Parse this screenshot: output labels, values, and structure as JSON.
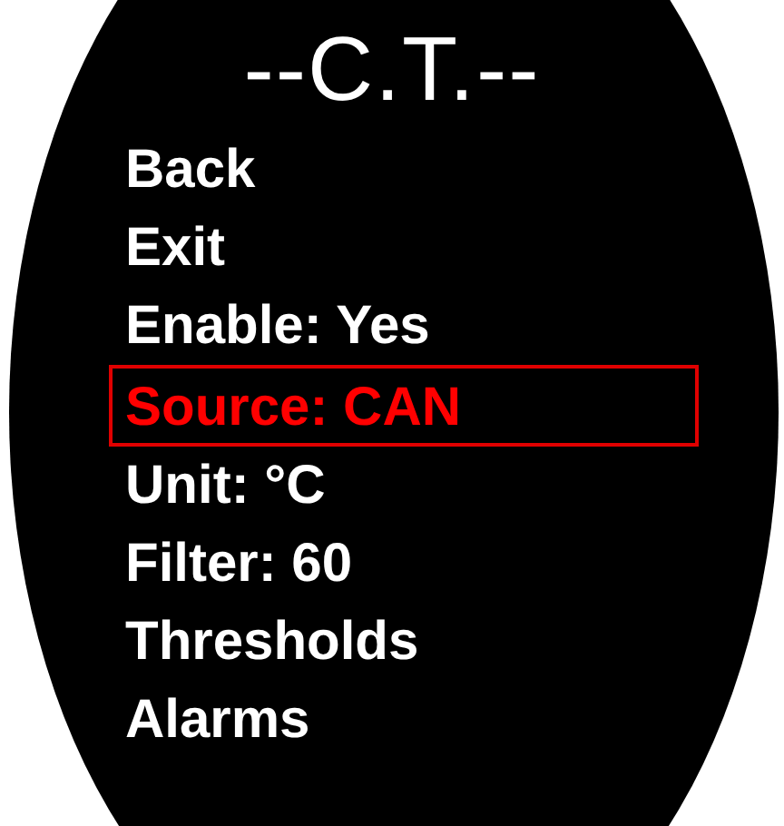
{
  "title": "--C.T.--",
  "menu": [
    {
      "label": "Back",
      "selected": false
    },
    {
      "label": "Exit",
      "selected": false
    },
    {
      "label": "Enable: Yes",
      "selected": false
    },
    {
      "label": "Source: CAN",
      "selected": true
    },
    {
      "label": "Unit: °C",
      "selected": false
    },
    {
      "label": "Filter: 60",
      "selected": false
    },
    {
      "label": "Thresholds",
      "selected": false
    },
    {
      "label": "Alarms",
      "selected": false
    }
  ]
}
